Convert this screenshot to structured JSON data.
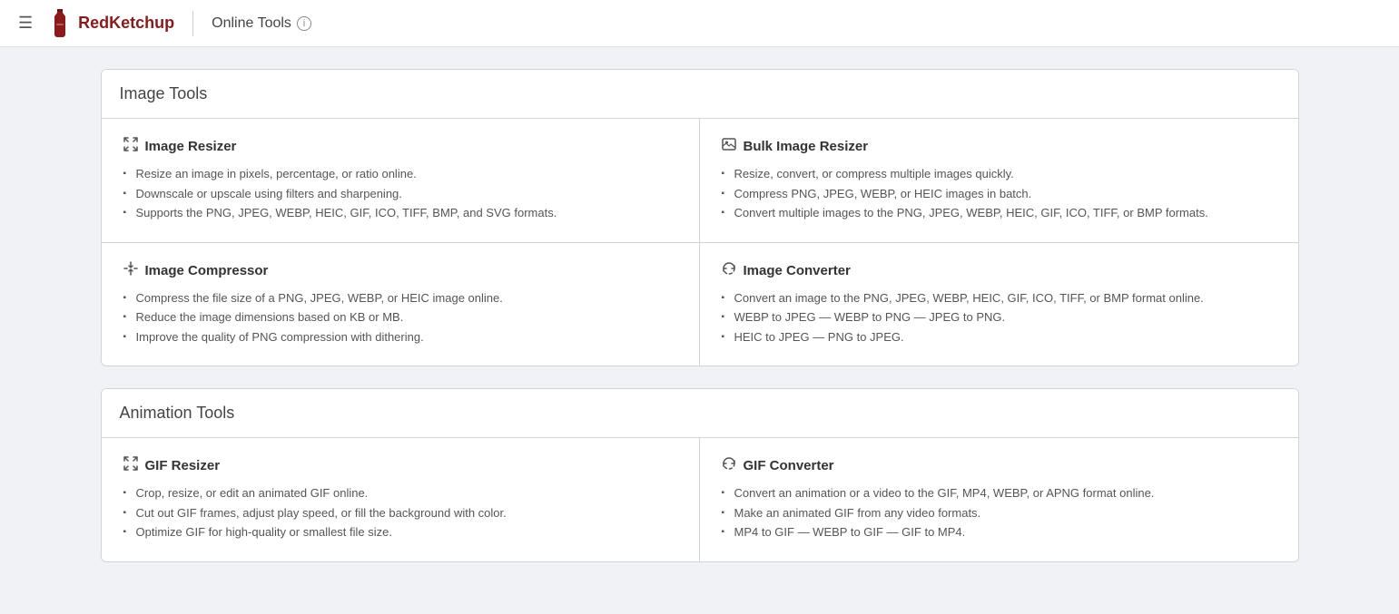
{
  "header": {
    "brand": "RedKetchup",
    "subtitle": "Online Tools",
    "menu_icon": "☰",
    "info_icon": "i"
  },
  "sections": [
    {
      "id": "image-tools",
      "title": "Image Tools",
      "tools": [
        {
          "id": "image-resizer",
          "icon": "resize",
          "title": "Image Resizer",
          "bullets": [
            "Resize an image in pixels, percentage, or ratio online.",
            "Downscale or upscale using filters and sharpening.",
            "Supports the PNG, JPEG, WEBP, HEIC, GIF, ICO, TIFF, BMP, and SVG formats."
          ]
        },
        {
          "id": "bulk-image-resizer",
          "icon": "image",
          "title": "Bulk Image Resizer",
          "bullets": [
            "Resize, convert, or compress multiple images quickly.",
            "Compress PNG, JPEG, WEBP, or HEIC images in batch.",
            "Convert multiple images to the PNG, JPEG, WEBP, HEIC, GIF, ICO, TIFF, or BMP formats."
          ]
        },
        {
          "id": "image-compressor",
          "icon": "compress",
          "title": "Image Compressor",
          "bullets": [
            "Compress the file size of a PNG, JPEG, WEBP, or HEIC image online.",
            "Reduce the image dimensions based on KB or MB.",
            "Improve the quality of PNG compression with dithering."
          ]
        },
        {
          "id": "image-converter",
          "icon": "convert",
          "title": "Image Converter",
          "bullets": [
            "Convert an image to the PNG, JPEG, WEBP, HEIC, GIF, ICO, TIFF, or BMP format online.",
            "WEBP to JPEG — WEBP to PNG — JPEG to PNG.",
            "HEIC to JPEG — PNG to JPEG."
          ]
        }
      ]
    },
    {
      "id": "animation-tools",
      "title": "Animation Tools",
      "tools": [
        {
          "id": "gif-resizer",
          "icon": "resize",
          "title": "GIF Resizer",
          "bullets": [
            "Crop, resize, or edit an animated GIF online.",
            "Cut out GIF frames, adjust play speed, or fill the background with color.",
            "Optimize GIF for high-quality or smallest file size."
          ]
        },
        {
          "id": "gif-converter",
          "icon": "convert",
          "title": "GIF Converter",
          "bullets": [
            "Convert an animation or a video to the GIF, MP4, WEBP, or APNG format online.",
            "Make an animated GIF from any video formats.",
            "MP4 to GIF — WEBP to GIF — GIF to MP4."
          ]
        }
      ]
    }
  ]
}
